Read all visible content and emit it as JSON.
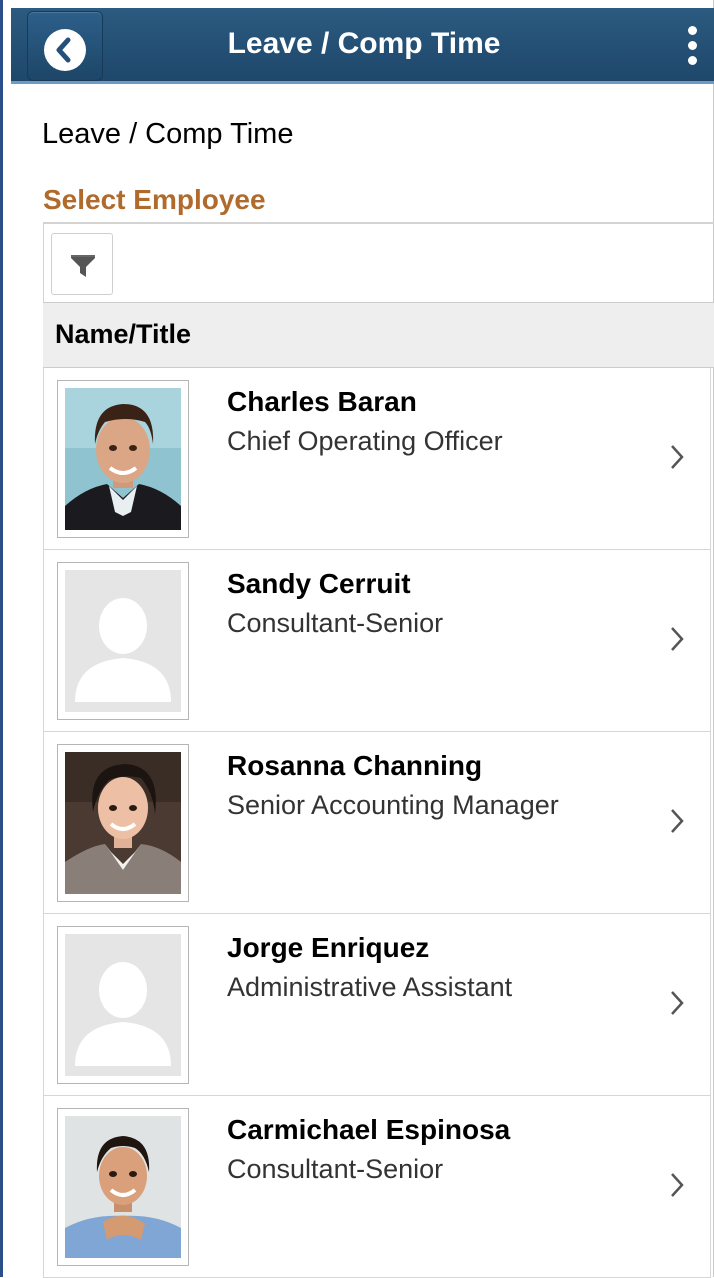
{
  "header": {
    "title": "Leave / Comp Time",
    "back_icon": "chevron-left-icon",
    "menu_icon": "vertical-ellipsis-icon",
    "color": "#24507a"
  },
  "page": {
    "title": "Leave / Comp Time",
    "section_label": "Select Employee",
    "filter_icon": "filter-icon",
    "column_header": "Name/Title",
    "accent": "#b06a2c"
  },
  "employees": [
    {
      "name": "Charles Baran",
      "title": "Chief Operating Officer",
      "photo": "photo-male-1"
    },
    {
      "name": "Sandy Cerruit",
      "title": "Consultant-Senior",
      "photo": "placeholder"
    },
    {
      "name": "Rosanna Channing",
      "title": "Senior Accounting Manager",
      "photo": "photo-female-1"
    },
    {
      "name": "Jorge Enriquez",
      "title": "Administrative Assistant",
      "photo": "placeholder"
    },
    {
      "name": "Carmichael Espinosa",
      "title": "Consultant-Senior",
      "photo": "photo-male-2"
    }
  ]
}
